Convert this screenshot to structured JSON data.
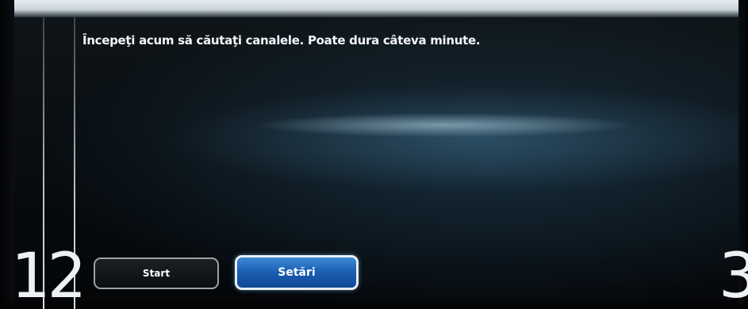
{
  "screen": {
    "message": "Începeţi acum să căutaţi canalele. Poate dura câteva minute.",
    "step_left": "12",
    "step_right": "3"
  },
  "buttons": {
    "start_label": "Start",
    "settings_label": "Setări"
  },
  "colors": {
    "selected_button": "#1a5cb0",
    "background": "#0a1014",
    "text": "#f2f5f7"
  }
}
